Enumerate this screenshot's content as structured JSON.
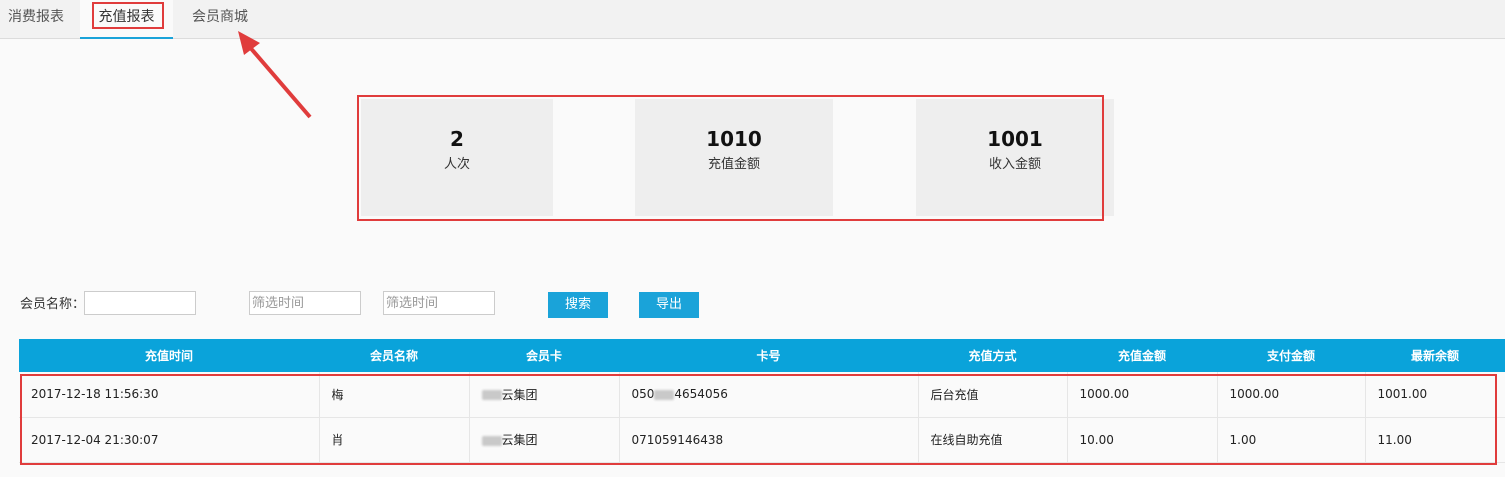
{
  "tabs": [
    {
      "label": "消费报表"
    },
    {
      "label": "充值报表"
    },
    {
      "label": "会员商城"
    }
  ],
  "stats": [
    {
      "value": "2",
      "label": "人次"
    },
    {
      "value": "1010",
      "label": "充值金额"
    },
    {
      "value": "1001",
      "label": "收入金额"
    }
  ],
  "filters": {
    "member_name_label": "会员名称：",
    "member_name_value": "",
    "time_placeholder_1": "筛选时间",
    "time_placeholder_2": "筛选时间",
    "search_label": "搜索",
    "export_label": "导出"
  },
  "table": {
    "headers": [
      "充值时间",
      "会员名称",
      "会员卡",
      "卡号",
      "充值方式",
      "充值金额",
      "支付金额",
      "最新余额"
    ],
    "rows": [
      [
        "2017-12-18 11:56:30",
        "梅",
        "云集团",
        "050",
        "4654056",
        "后台充值",
        "1000.00",
        "1000.00",
        "1001.00"
      ],
      [
        "2017-12-04 21:30:07",
        "肖",
        "云集团",
        "071059146438",
        "",
        "在线自助充值",
        "10.00",
        "1.00",
        "11.00"
      ]
    ]
  },
  "colors": {
    "accent": "#0aa3da",
    "annotation": "#e03c3c"
  }
}
